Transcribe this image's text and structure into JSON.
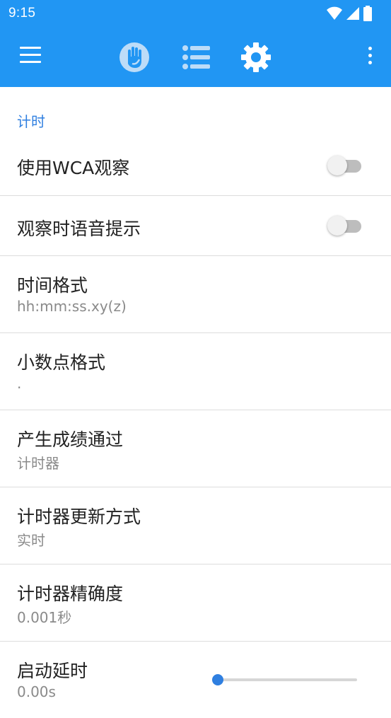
{
  "status_bar": {
    "time": "9:15",
    "icons": [
      "wifi-icon",
      "signal-icon",
      "battery-icon"
    ]
  },
  "app_bar": {
    "icons": [
      "menu-icon",
      "hand-icon",
      "list-icon",
      "gear-icon",
      "more-vert-icon"
    ],
    "color": "#2196f3"
  },
  "section": {
    "header": "计时"
  },
  "settings": [
    {
      "title": "使用WCA观察",
      "type": "switch",
      "checked": false
    },
    {
      "title": "观察时语音提示",
      "type": "switch",
      "checked": false
    },
    {
      "title": "时间格式",
      "summary": "hh:mm:ss.xy(z)"
    },
    {
      "title": "小数点格式",
      "summary": "."
    },
    {
      "title": "产生成绩通过",
      "summary": "计时器"
    },
    {
      "title": "计时器更新方式",
      "summary": "实时"
    },
    {
      "title": "计时器精确度",
      "summary": "0.001秒"
    },
    {
      "title": "启动延时",
      "summary": "0.00s",
      "type": "slider",
      "value": 0
    }
  ],
  "accent_color": "#2f7fe0"
}
